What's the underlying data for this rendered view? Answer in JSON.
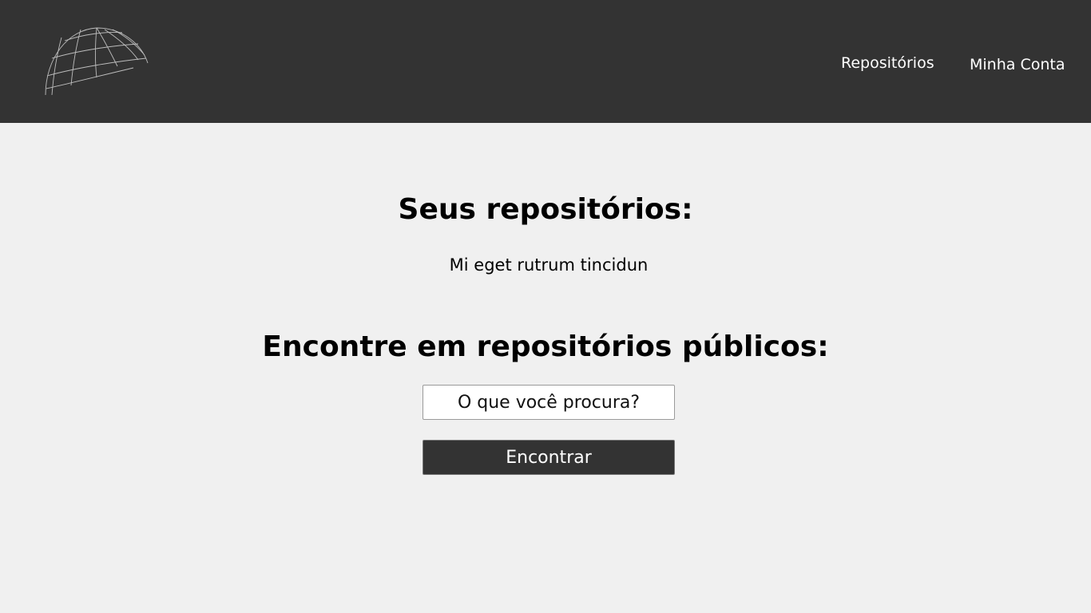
{
  "header": {
    "logo_icon": "globe-wireframe-icon",
    "nav": {
      "repositories_label": "Repositórios",
      "account_label": "Minha Conta"
    }
  },
  "main": {
    "your_repos_title": "Seus repositórios:",
    "your_repos": [
      "Mi eget rutrum tincidun"
    ],
    "public_search_title": "Encontre em repositórios públicos:",
    "search": {
      "placeholder": "O que você procura?",
      "value": ""
    },
    "find_button_label": "Encontrar"
  },
  "colors": {
    "header_bg": "#333333",
    "page_bg": "#f0f0f0",
    "button_bg": "#333333",
    "nav_text": "#ffffff"
  }
}
